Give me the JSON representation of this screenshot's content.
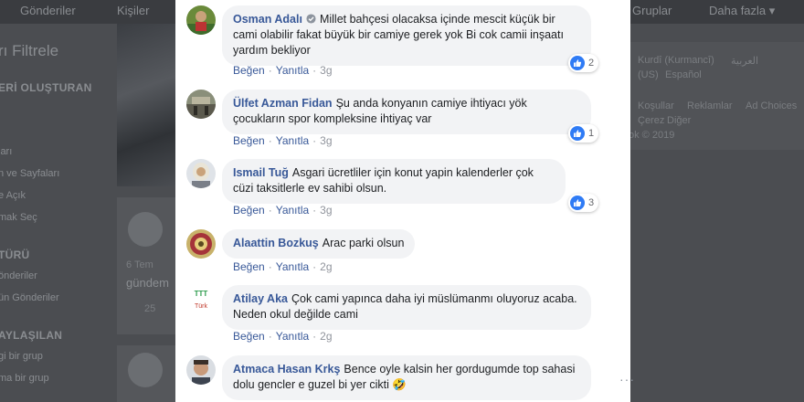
{
  "background": {
    "nav": [
      "Gönderiler",
      "Kişiler",
      "Gruplar",
      "Daha fazla"
    ],
    "left_texts": [
      "rı Filtrele",
      "ERİ OLUŞTURAN",
      "ları",
      "n ve Sayfaları",
      "e Açık",
      "mak Seç",
      "TÜRÜ",
      "önderiler",
      "ün Gönderiler",
      "AYLAŞILAN",
      "gi bir grup",
      "ma bir grup",
      "6 Tem",
      "gündem",
      "25"
    ],
    "right_texts": [
      "Kurdî (Kurmancî)",
      "العربية",
      "(US)",
      "Español",
      "Koşullar",
      "Reklamlar",
      "Ad Choices",
      "Çerez",
      "Diğer",
      "ok © 2019"
    ]
  },
  "comments": [
    {
      "author": "Osman Adalı",
      "verified": true,
      "text": "Millet bahçesi olacaksa içinde mescit küçük bir cami olabilir fakat büyük bir camiye gerek yok Bi cok camii inşaatı yardım bekliyor",
      "like_label": "Beğen",
      "reply_label": "Yanıtla",
      "time": "3g",
      "reactions": "2"
    },
    {
      "author": "Ülfet Azman Fidan",
      "verified": false,
      "text": "Şu anda konyanın camiye ihtiyacı yök çocukların spor kompleksine ihtiyaç var",
      "like_label": "Beğen",
      "reply_label": "Yanıtla",
      "time": "3g",
      "reactions": "1"
    },
    {
      "author": "Ismail Tuğ",
      "verified": false,
      "text": "Asgari ücretliler için konut yapin kalenderler çok cüzi taksitlerle ev sahibi olsun.",
      "like_label": "Beğen",
      "reply_label": "Yanıtla",
      "time": "3g",
      "reactions": "3"
    },
    {
      "author": "Alaattin Bozkuş",
      "verified": false,
      "text": "Arac parki olsun",
      "like_label": "Beğen",
      "reply_label": "Yanıtla",
      "time": "2g",
      "reactions": ""
    },
    {
      "author": "Atilay Aka",
      "verified": false,
      "text": "Çok cami yapınca daha iyi müslümanmı oluyoruz acaba. Neden okul değilde cami",
      "like_label": "Beğen",
      "reply_label": "Yanıtla",
      "time": "2g",
      "reactions": ""
    },
    {
      "author": "Atmaca Hasan Krkş",
      "verified": false,
      "text": "Bence oyle kalsin her gordugumde top sahasi dolu gencler e guzel bi yer cikti 🤣",
      "like_label": "",
      "reply_label": "",
      "time": "",
      "reactions": ""
    }
  ],
  "colors": {
    "author_link": "#385898",
    "bubble_bg": "#f2f3f5",
    "like_blue": "#2f7bf5",
    "overlay_bg": "#4b4d51"
  }
}
